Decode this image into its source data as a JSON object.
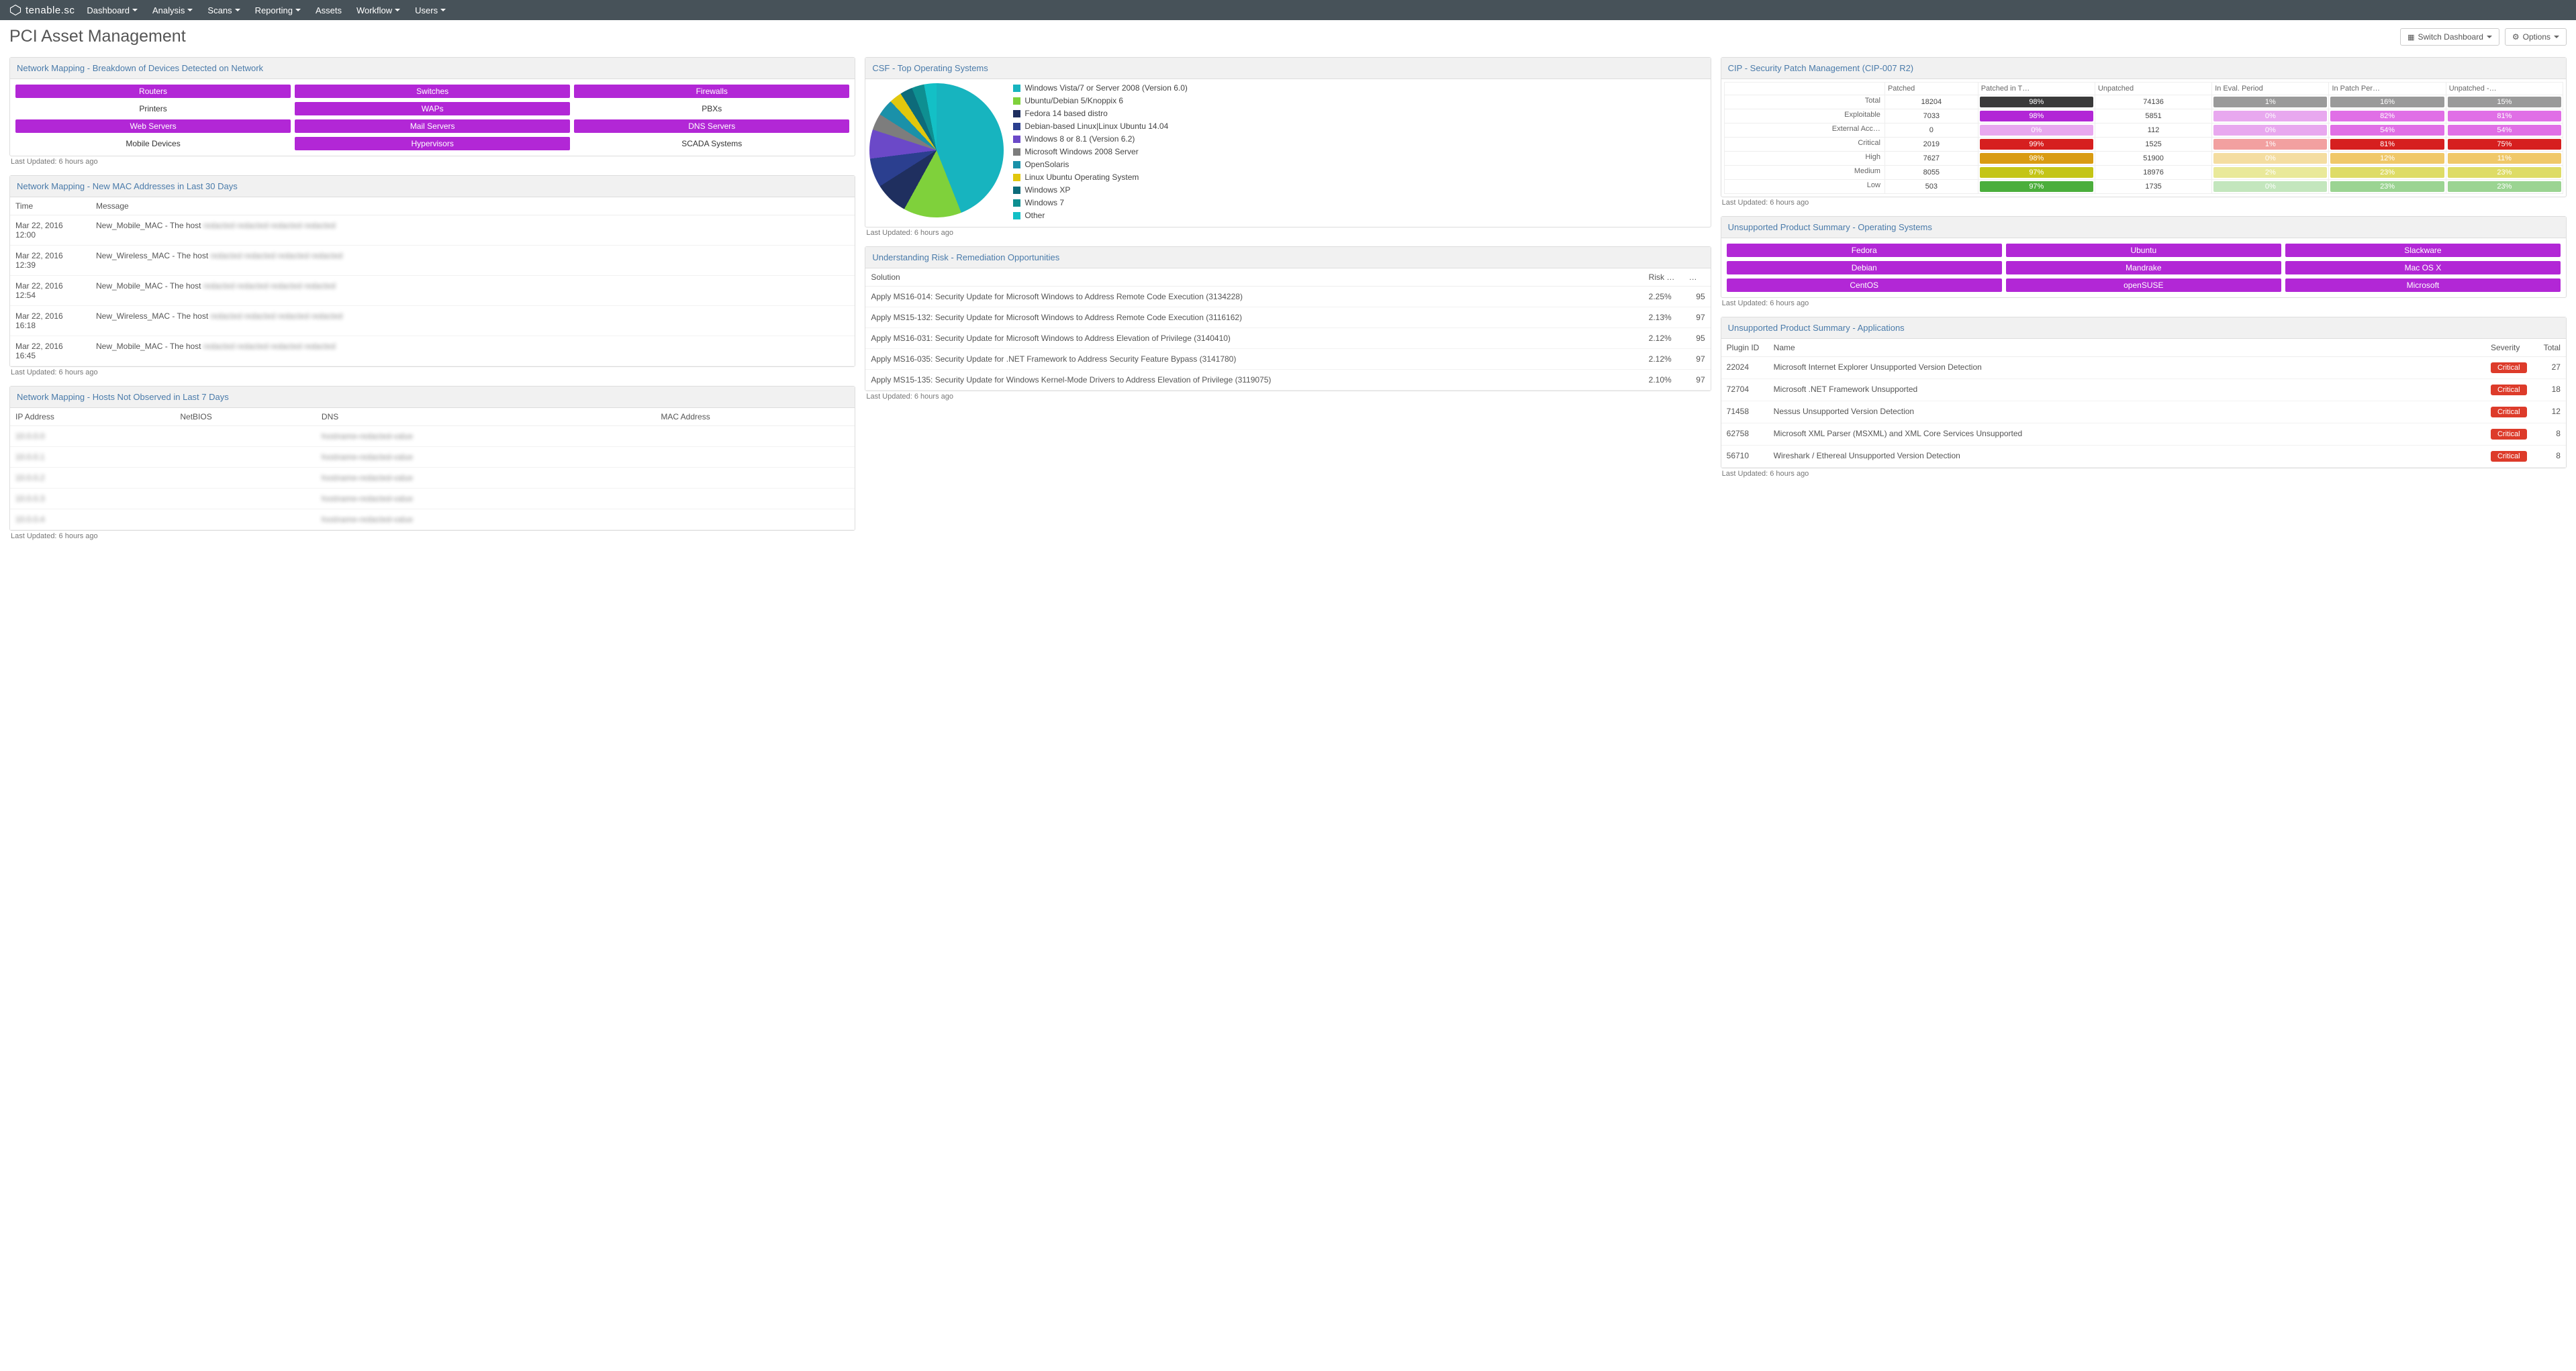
{
  "brand": "tenable.sc",
  "nav": [
    "Dashboard",
    "Analysis",
    "Scans",
    "Reporting",
    "Assets",
    "Workflow",
    "Users"
  ],
  "page_title": "PCI Asset Management",
  "btn_switch": "Switch Dashboard",
  "btn_options": "Options",
  "last_updated": "Last Updated: 6 hours ago",
  "nm_devices": {
    "title": "Network Mapping - Breakdown of Devices Detected on Network",
    "items": [
      {
        "label": "Routers",
        "filled": true
      },
      {
        "label": "Switches",
        "filled": true
      },
      {
        "label": "Firewalls",
        "filled": true
      },
      {
        "label": "Printers",
        "filled": false
      },
      {
        "label": "WAPs",
        "filled": true
      },
      {
        "label": "PBXs",
        "filled": false
      },
      {
        "label": "Web Servers",
        "filled": true
      },
      {
        "label": "Mail Servers",
        "filled": true
      },
      {
        "label": "DNS Servers",
        "filled": true
      },
      {
        "label": "Mobile Devices",
        "filled": false
      },
      {
        "label": "Hypervisors",
        "filled": true
      },
      {
        "label": "SCADA Systems",
        "filled": false
      }
    ]
  },
  "nm_mac": {
    "title": "Network Mapping - New MAC Addresses in Last 30 Days",
    "cols": [
      "Time",
      "Message"
    ],
    "rows": [
      {
        "time": "Mar 22, 2016 12:00",
        "msg": "New_Mobile_MAC - The host"
      },
      {
        "time": "Mar 22, 2016 12:39",
        "msg": "New_Wireless_MAC - The host"
      },
      {
        "time": "Mar 22, 2016 12:54",
        "msg": "New_Mobile_MAC - The host"
      },
      {
        "time": "Mar 22, 2016 16:18",
        "msg": "New_Wireless_MAC - The host"
      },
      {
        "time": "Mar 22, 2016 16:45",
        "msg": "New_Mobile_MAC - The host"
      }
    ]
  },
  "nm_hosts": {
    "title": "Network Mapping - Hosts Not Observed in Last 7 Days",
    "cols": [
      "IP Address",
      "NetBIOS",
      "DNS",
      "MAC Address"
    ],
    "rows": 5
  },
  "csf": {
    "title": "CSF - Top Operating Systems",
    "legend": [
      {
        "c": "#17b4bf",
        "t": "Windows Vista/7 or Server 2008 (Version 6.0)"
      },
      {
        "c": "#7fd13b",
        "t": "Ubuntu/Debian 5/Knoppix 6"
      },
      {
        "c": "#1f2f5f",
        "t": "Fedora 14 based distro"
      },
      {
        "c": "#2b3f8f",
        "t": "Debian-based Linux|Linux Ubuntu 14.04"
      },
      {
        "c": "#6b49c8",
        "t": "Windows 8 or 8.1 (Version 6.2)"
      },
      {
        "c": "#7d7d7d",
        "t": "Microsoft Windows 2008 Server"
      },
      {
        "c": "#1a91a9",
        "t": "OpenSolaris"
      },
      {
        "c": "#e1c70d",
        "t": "Linux Ubuntu Operating System"
      },
      {
        "c": "#0d6b7a",
        "t": "Windows XP"
      },
      {
        "c": "#0e8f91",
        "t": "Windows 7"
      },
      {
        "c": "#13c0c6",
        "t": "Other"
      }
    ]
  },
  "risk": {
    "title": "Understanding Risk - Remediation Opportunities",
    "cols": [
      "Solution",
      "Risk …",
      "…"
    ],
    "rows": [
      {
        "s": "Apply MS16-014: Security Update for Microsoft Windows to Address Remote Code Execution (3134228)",
        "r": "2.25%",
        "n": "95"
      },
      {
        "s": "Apply MS15-132: Security Update for Microsoft Windows to Address Remote Code Execution (3116162)",
        "r": "2.13%",
        "n": "97"
      },
      {
        "s": "Apply MS16-031: Security Update for Microsoft Windows to Address Elevation of Privilege (3140410)",
        "r": "2.12%",
        "n": "95"
      },
      {
        "s": "Apply MS16-035: Security Update for .NET Framework to Address Security Feature Bypass (3141780)",
        "r": "2.12%",
        "n": "97"
      },
      {
        "s": "Apply MS15-135: Security Update for Windows Kernel-Mode Drivers to Address Elevation of Privilege (3119075)",
        "r": "2.10%",
        "n": "97"
      }
    ]
  },
  "cip": {
    "title": "CIP - Security Patch Management (CIP-007 R2)",
    "cols": [
      "",
      "Patched",
      "Patched in T…",
      "Unpatched",
      "In Eval. Period",
      "In Patch Per…",
      "Unpatched -…"
    ],
    "rows": [
      {
        "l": "Total",
        "v": [
          "18204",
          {
            "t": "98%",
            "c": "#3a3a3a"
          },
          "74136",
          {
            "t": "1%",
            "c": "#9a9a9a"
          },
          {
            "t": "16%",
            "c": "#9a9a9a"
          },
          {
            "t": "15%",
            "c": "#9a9a9a"
          }
        ]
      },
      {
        "l": "Exploitable",
        "v": [
          "7033",
          {
            "t": "98%",
            "c": "#b227d6"
          },
          "5851",
          {
            "t": "0%",
            "c": "#e8a8ef"
          },
          {
            "t": "82%",
            "c": "#e06fe6"
          },
          {
            "t": "81%",
            "c": "#e06fe6"
          }
        ]
      },
      {
        "l": "External Acc…",
        "v": [
          "0",
          {
            "t": "0%",
            "c": "#e8a8ef"
          },
          "112",
          {
            "t": "0%",
            "c": "#e8a8ef"
          },
          {
            "t": "54%",
            "c": "#e06fe6"
          },
          {
            "t": "54%",
            "c": "#e06fe6"
          }
        ]
      },
      {
        "l": "Critical",
        "v": [
          "2019",
          {
            "t": "99%",
            "c": "#d61f1f"
          },
          "1525",
          {
            "t": "1%",
            "c": "#f2a0a0"
          },
          {
            "t": "81%",
            "c": "#d61f1f"
          },
          {
            "t": "75%",
            "c": "#d61f1f"
          }
        ]
      },
      {
        "l": "High",
        "v": [
          "7627",
          {
            "t": "98%",
            "c": "#d99b12"
          },
          "51900",
          {
            "t": "0%",
            "c": "#f4dda1"
          },
          {
            "t": "12%",
            "c": "#f0c869"
          },
          {
            "t": "11%",
            "c": "#f0c869"
          }
        ]
      },
      {
        "l": "Medium",
        "v": [
          "8055",
          {
            "t": "97%",
            "c": "#c4c516"
          },
          "18976",
          {
            "t": "2%",
            "c": "#e9e99a"
          },
          {
            "t": "23%",
            "c": "#dedc66"
          },
          {
            "t": "23%",
            "c": "#dedc66"
          }
        ]
      },
      {
        "l": "Low",
        "v": [
          "503",
          {
            "t": "97%",
            "c": "#4bae3c"
          },
          "1735",
          {
            "t": "0%",
            "c": "#c3e6bd"
          },
          {
            "t": "23%",
            "c": "#9bd492"
          },
          {
            "t": "23%",
            "c": "#9bd492"
          }
        ]
      }
    ]
  },
  "ups_os": {
    "title": "Unsupported Product Summary - Operating Systems",
    "items": [
      "Fedora",
      "Ubuntu",
      "Slackware",
      "Debian",
      "Mandrake",
      "Mac OS X",
      "CentOS",
      "openSUSE",
      "Microsoft"
    ]
  },
  "ups_app": {
    "title": "Unsupported Product Summary - Applications",
    "cols": [
      "Plugin ID",
      "Name",
      "Severity",
      "Total"
    ],
    "rows": [
      {
        "id": "22024",
        "n": "Microsoft Internet Explorer Unsupported Version Detection",
        "s": "Critical",
        "t": "27"
      },
      {
        "id": "72704",
        "n": "Microsoft .NET Framework Unsupported",
        "s": "Critical",
        "t": "18"
      },
      {
        "id": "71458",
        "n": "Nessus Unsupported Version Detection",
        "s": "Critical",
        "t": "12"
      },
      {
        "id": "62758",
        "n": "Microsoft XML Parser (MSXML) and XML Core Services Unsupported",
        "s": "Critical",
        "t": "8"
      },
      {
        "id": "56710",
        "n": "Wireshark / Ethereal Unsupported Version Detection",
        "s": "Critical",
        "t": "8"
      }
    ]
  },
  "chart_data": {
    "type": "pie",
    "title": "CSF - Top Operating Systems",
    "series": [
      {
        "name": "Windows Vista/7 or Server 2008 (Version 6.0)",
        "value": 44,
        "color": "#17b4bf"
      },
      {
        "name": "Ubuntu/Debian 5/Knoppix 6",
        "value": 14,
        "color": "#7fd13b"
      },
      {
        "name": "Fedora 14 based distro",
        "value": 8,
        "color": "#1f2f5f"
      },
      {
        "name": "Debian-based Linux|Linux Ubuntu 14.04",
        "value": 7,
        "color": "#2b3f8f"
      },
      {
        "name": "Windows 8 or 8.1 (Version 6.2)",
        "value": 7,
        "color": "#6b49c8"
      },
      {
        "name": "Microsoft Windows 2008 Server",
        "value": 4,
        "color": "#7d7d7d"
      },
      {
        "name": "OpenSolaris",
        "value": 4,
        "color": "#1a91a9"
      },
      {
        "name": "Linux Ubuntu Operating System",
        "value": 3,
        "color": "#e1c70d"
      },
      {
        "name": "Windows XP",
        "value": 3,
        "color": "#0d6b7a"
      },
      {
        "name": "Windows 7",
        "value": 3,
        "color": "#0e8f91"
      },
      {
        "name": "Other",
        "value": 3,
        "color": "#13c0c6"
      }
    ]
  }
}
